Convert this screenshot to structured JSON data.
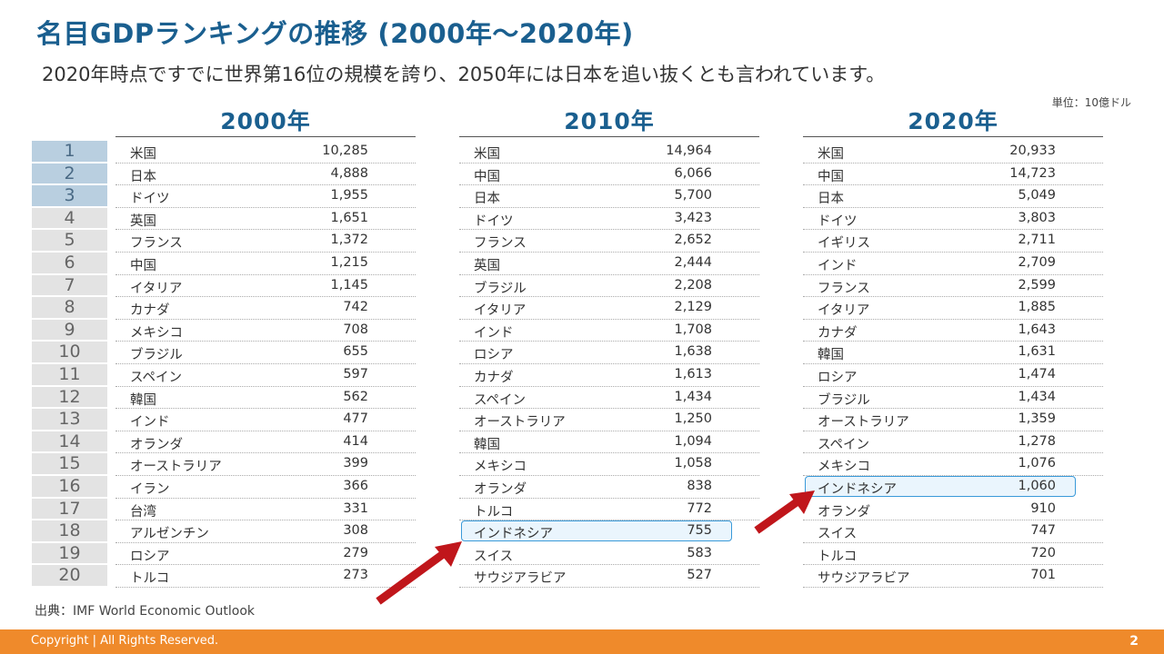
{
  "title": "名目GDPランキングの推移 (2000年〜2020年)",
  "subtitle": "2020年時点ですでに世界第16位の規模を誇り、2050年には日本を追い抜くとも言われています。",
  "unit": "単位：10億ドル",
  "ranks": [
    "1",
    "2",
    "3",
    "4",
    "5",
    "6",
    "7",
    "8",
    "9",
    "10",
    "11",
    "12",
    "13",
    "14",
    "15",
    "16",
    "17",
    "18",
    "19",
    "20"
  ],
  "years": [
    {
      "label": "2000年",
      "rows": [
        {
          "country": "米国",
          "value": "10,285"
        },
        {
          "country": "日本",
          "value": "4,888"
        },
        {
          "country": "ドイツ",
          "value": "1,955"
        },
        {
          "country": "英国",
          "value": "1,651"
        },
        {
          "country": "フランス",
          "value": "1,372"
        },
        {
          "country": "中国",
          "value": "1,215"
        },
        {
          "country": "イタリア",
          "value": "1,145"
        },
        {
          "country": "カナダ",
          "value": "742"
        },
        {
          "country": "メキシコ",
          "value": "708"
        },
        {
          "country": "ブラジル",
          "value": "655"
        },
        {
          "country": "スペイン",
          "value": "597"
        },
        {
          "country": "韓国",
          "value": "562"
        },
        {
          "country": "インド",
          "value": "477"
        },
        {
          "country": "オランダ",
          "value": "414"
        },
        {
          "country": "オーストラリア",
          "value": "399"
        },
        {
          "country": "イラン",
          "value": "366"
        },
        {
          "country": "台湾",
          "value": "331"
        },
        {
          "country": "アルゼンチン",
          "value": "308"
        },
        {
          "country": "ロシア",
          "value": "279"
        },
        {
          "country": "トルコ",
          "value": "273"
        }
      ]
    },
    {
      "label": "2010年",
      "rows": [
        {
          "country": "米国",
          "value": "14,964"
        },
        {
          "country": "中国",
          "value": "6,066"
        },
        {
          "country": "日本",
          "value": "5,700"
        },
        {
          "country": "ドイツ",
          "value": "3,423"
        },
        {
          "country": "フランス",
          "value": "2,652"
        },
        {
          "country": "英国",
          "value": "2,444"
        },
        {
          "country": "ブラジル",
          "value": "2,208"
        },
        {
          "country": "イタリア",
          "value": "2,129"
        },
        {
          "country": "インド",
          "value": "1,708"
        },
        {
          "country": "ロシア",
          "value": "1,638"
        },
        {
          "country": "カナダ",
          "value": "1,613"
        },
        {
          "country": "スペイン",
          "value": "1,434"
        },
        {
          "country": "オーストラリア",
          "value": "1,250"
        },
        {
          "country": "韓国",
          "value": "1,094"
        },
        {
          "country": "メキシコ",
          "value": "1,058"
        },
        {
          "country": "オランダ",
          "value": "838"
        },
        {
          "country": "トルコ",
          "value": "772"
        },
        {
          "country": "インドネシア",
          "value": "755"
        },
        {
          "country": "スイス",
          "value": "583"
        },
        {
          "country": "サウジアラビア",
          "value": "527"
        }
      ]
    },
    {
      "label": "2020年",
      "rows": [
        {
          "country": "米国",
          "value": "20,933"
        },
        {
          "country": "中国",
          "value": "14,723"
        },
        {
          "country": "日本",
          "value": "5,049"
        },
        {
          "country": "ドイツ",
          "value": "3,803"
        },
        {
          "country": "イギリス",
          "value": "2,711"
        },
        {
          "country": "インド",
          "value": "2,709"
        },
        {
          "country": "フランス",
          "value": "2,599"
        },
        {
          "country": "イタリア",
          "value": "1,885"
        },
        {
          "country": "カナダ",
          "value": "1,643"
        },
        {
          "country": "韓国",
          "value": "1,631"
        },
        {
          "country": "ロシア",
          "value": "1,474"
        },
        {
          "country": "ブラジル",
          "value": "1,434"
        },
        {
          "country": "オーストラリア",
          "value": "1,359"
        },
        {
          "country": "スペイン",
          "value": "1,278"
        },
        {
          "country": "メキシコ",
          "value": "1,076"
        },
        {
          "country": "インドネシア",
          "value": "1,060"
        },
        {
          "country": "オランダ",
          "value": "910"
        },
        {
          "country": "スイス",
          "value": "747"
        },
        {
          "country": "トルコ",
          "value": "720"
        },
        {
          "country": "サウジアラビア",
          "value": "701"
        }
      ]
    }
  ],
  "highlight_country": "インドネシア",
  "source": "出典：IMF World Economic Outlook",
  "footer": {
    "copyright": "Copyright | All Rights Reserved.",
    "page": "2"
  },
  "colors": {
    "title": "#1a5f8f",
    "footer": "#ef8a2b",
    "arrow": "#c0161b",
    "highlight": "#3a9ad9"
  }
}
